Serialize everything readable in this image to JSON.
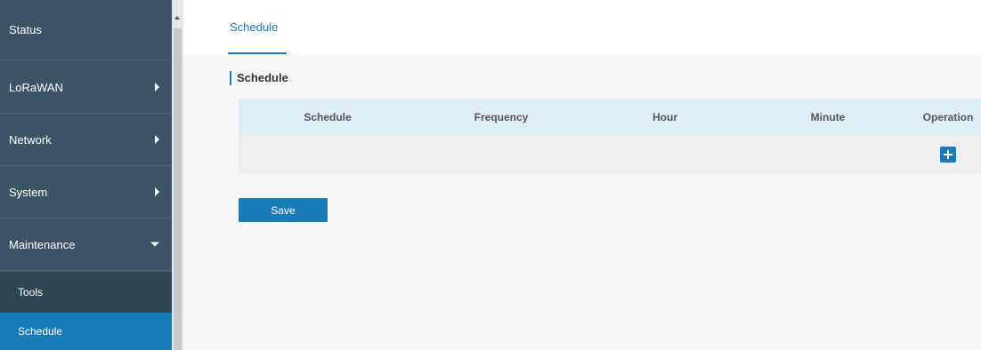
{
  "sidebar": {
    "items": [
      {
        "label": "Status"
      },
      {
        "label": "LoRaWAN"
      },
      {
        "label": "Network"
      },
      {
        "label": "System"
      },
      {
        "label": "Maintenance"
      }
    ],
    "sub_items": [
      {
        "label": "Tools"
      },
      {
        "label": "Schedule"
      }
    ]
  },
  "tabs": [
    {
      "label": "Schedule"
    }
  ],
  "section": {
    "title": "Schedule"
  },
  "table": {
    "columns": [
      "Schedule",
      "Frequency",
      "Hour",
      "Minute",
      "Operation"
    ]
  },
  "actions": {
    "save_label": "Save"
  },
  "colors": {
    "sidebar_bg": "#3b5566",
    "accent": "#1a7bb9",
    "table_header_bg": "#dfeef6"
  },
  "icons": [
    "arrow-right-icon",
    "arrow-down-icon",
    "plus-icon",
    "scroll-up-icon"
  ]
}
